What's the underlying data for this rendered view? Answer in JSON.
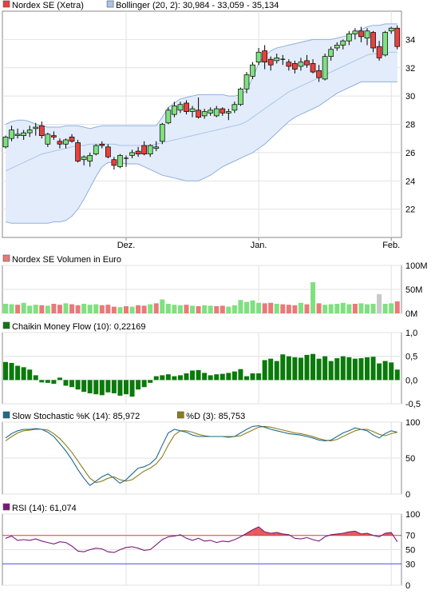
{
  "chart_data": [
    {
      "type": "candlestick",
      "title": "Nordex SE (Xetra)",
      "legend": [
        {
          "swatch": "#e8413c",
          "text": "Nordex SE (Xetra)"
        },
        {
          "swatch": "#a9c4ea",
          "text": "Bollinger (20, 2): 30,984 - 33,059 - 35,134"
        }
      ],
      "ylim": [
        20,
        36
      ],
      "yticks": [
        22,
        24,
        26,
        28,
        30,
        32,
        34
      ],
      "ytick_labels": [
        "22",
        "24",
        "26",
        "28",
        "30",
        "32",
        "34"
      ],
      "xtick_labels": [
        {
          "index": 20,
          "label": "Dez."
        },
        {
          "index": 42,
          "label": "Jan."
        },
        {
          "index": 64,
          "label": "Feb."
        }
      ],
      "ohlc": [
        [
          26.4,
          27.2,
          26.3,
          27.1
        ],
        [
          27.0,
          27.9,
          26.8,
          27.6
        ],
        [
          27.2,
          27.7,
          27.0,
          27.3
        ],
        [
          27.2,
          27.6,
          26.9,
          27.4
        ],
        [
          27.4,
          27.9,
          27.1,
          27.6
        ],
        [
          27.7,
          28.1,
          27.2,
          27.8
        ],
        [
          27.9,
          28.2,
          27.0,
          27.2
        ],
        [
          26.6,
          27.4,
          26.4,
          27.3
        ],
        [
          27.2,
          27.5,
          26.9,
          27.1
        ],
        [
          26.8,
          27.0,
          26.3,
          26.6
        ],
        [
          26.6,
          27.0,
          26.3,
          26.9
        ],
        [
          27.1,
          27.3,
          26.7,
          26.8
        ],
        [
          26.7,
          26.9,
          25.3,
          25.4
        ],
        [
          25.5,
          25.8,
          25.1,
          25.7
        ],
        [
          25.4,
          26.0,
          25.0,
          25.8
        ],
        [
          25.9,
          26.6,
          25.8,
          26.5
        ],
        [
          26.6,
          26.8,
          26.3,
          26.5
        ],
        [
          26.4,
          26.6,
          25.6,
          25.7
        ],
        [
          25.5,
          25.7,
          24.8,
          25.1
        ],
        [
          25.0,
          25.9,
          24.9,
          25.8
        ],
        [
          25.6,
          25.8,
          25.0,
          25.6
        ],
        [
          25.8,
          26.2,
          25.6,
          26.0
        ],
        [
          26.1,
          26.4,
          25.7,
          25.9
        ],
        [
          26.5,
          26.8,
          25.8,
          25.9
        ],
        [
          25.9,
          26.6,
          25.7,
          26.5
        ],
        [
          26.3,
          26.8,
          26.1,
          26.4
        ],
        [
          26.8,
          28.1,
          26.6,
          28.0
        ],
        [
          28.1,
          29.2,
          28.0,
          29.0
        ],
        [
          28.7,
          29.6,
          28.5,
          29.3
        ],
        [
          29.0,
          29.6,
          28.8,
          29.4
        ],
        [
          29.5,
          29.7,
          28.7,
          28.9
        ],
        [
          28.9,
          29.3,
          28.5,
          29.1
        ],
        [
          29.0,
          29.9,
          28.4,
          28.5
        ],
        [
          28.6,
          29.1,
          28.4,
          28.9
        ],
        [
          28.8,
          29.2,
          28.6,
          29.0
        ],
        [
          28.6,
          29.3,
          28.5,
          29.1
        ],
        [
          29.1,
          29.2,
          28.6,
          28.8
        ],
        [
          28.8,
          29.1,
          28.3,
          28.9
        ],
        [
          29.0,
          29.6,
          28.8,
          29.4
        ],
        [
          29.4,
          30.6,
          29.3,
          30.5
        ],
        [
          30.5,
          31.7,
          30.2,
          31.5
        ],
        [
          31.4,
          32.4,
          31.2,
          32.2
        ],
        [
          32.4,
          33.4,
          32.2,
          33.1
        ],
        [
          33.2,
          33.6,
          31.9,
          32.4
        ],
        [
          32.6,
          32.8,
          31.8,
          32.2
        ],
        [
          32.5,
          33.0,
          32.3,
          32.7
        ],
        [
          32.6,
          32.9,
          32.2,
          32.6
        ],
        [
          32.4,
          32.6,
          31.8,
          32.1
        ],
        [
          32.3,
          32.5,
          31.6,
          31.9
        ],
        [
          32.1,
          32.7,
          31.8,
          32.4
        ],
        [
          32.5,
          32.9,
          32.0,
          32.2
        ],
        [
          32.3,
          32.6,
          31.6,
          31.7
        ],
        [
          31.8,
          32.2,
          31.0,
          31.3
        ],
        [
          31.2,
          33.0,
          31.1,
          32.8
        ],
        [
          32.8,
          33.5,
          32.5,
          33.3
        ],
        [
          33.4,
          33.8,
          33.2,
          33.6
        ],
        [
          33.6,
          34.0,
          33.3,
          33.9
        ],
        [
          33.9,
          34.6,
          33.6,
          34.4
        ],
        [
          34.4,
          34.8,
          34.0,
          34.6
        ],
        [
          34.6,
          34.9,
          33.8,
          34.2
        ],
        [
          34.1,
          34.8,
          33.6,
          34.6
        ],
        [
          34.5,
          34.6,
          33.1,
          33.4
        ],
        [
          33.5,
          33.9,
          32.5,
          32.7
        ],
        [
          32.9,
          34.6,
          32.8,
          34.5
        ],
        [
          34.6,
          34.9,
          34.4,
          34.8
        ],
        [
          34.8,
          35.0,
          33.3,
          33.5
        ]
      ],
      "bollinger_upper": [
        28.0,
        28.2,
        28.3,
        28.3,
        28.2,
        28.0,
        27.9,
        27.8,
        27.8,
        27.8,
        27.9,
        27.9,
        27.9,
        27.8,
        27.7,
        27.8,
        27.9,
        27.9,
        27.9,
        27.9,
        27.9,
        27.9,
        27.9,
        27.9,
        27.9,
        27.9,
        28.5,
        29.2,
        29.5,
        29.8,
        29.9,
        30.0,
        30.1,
        30.1,
        30.1,
        30.1,
        30.1,
        30.0,
        30.0,
        30.1,
        30.4,
        31.3,
        32.3,
        32.8,
        33.2,
        33.4,
        33.5,
        33.6,
        33.7,
        33.8,
        33.9,
        34.0,
        34.0,
        34.0,
        34.0,
        34.1,
        34.2,
        34.3,
        34.5,
        34.7,
        34.9,
        35.0,
        35.0,
        35.1,
        35.1,
        35.1
      ],
      "bollinger_mid": [
        24.7,
        24.9,
        25.1,
        25.3,
        25.5,
        25.7,
        25.9,
        26.0,
        26.1,
        26.2,
        26.3,
        26.4,
        26.5,
        26.5,
        26.6,
        26.6,
        26.6,
        26.6,
        26.6,
        26.5,
        26.5,
        26.5,
        26.5,
        26.5,
        26.5,
        26.6,
        26.7,
        26.8,
        26.9,
        27.0,
        27.1,
        27.2,
        27.3,
        27.4,
        27.5,
        27.6,
        27.7,
        27.8,
        27.9,
        28.0,
        28.2,
        28.5,
        28.8,
        29.1,
        29.4,
        29.7,
        30.0,
        30.3,
        30.5,
        30.7,
        30.9,
        31.1,
        31.3,
        31.5,
        31.7,
        31.9,
        32.1,
        32.3,
        32.5,
        32.7,
        32.9,
        33.0,
        33.0,
        33.0,
        33.1,
        33.1
      ],
      "bollinger_lower": [
        21.1,
        21.0,
        21.0,
        21.0,
        21.0,
        21.0,
        21.0,
        21.0,
        21.1,
        21.1,
        21.2,
        21.5,
        22.0,
        22.7,
        23.5,
        24.3,
        25.0,
        25.3,
        25.3,
        25.3,
        25.2,
        25.2,
        25.2,
        25.0,
        24.8,
        24.6,
        24.4,
        24.3,
        24.2,
        24.1,
        24.0,
        24.0,
        24.0,
        24.2,
        24.4,
        24.7,
        25.0,
        25.2,
        25.4,
        25.6,
        25.8,
        26.0,
        26.3,
        26.6,
        27.0,
        27.4,
        27.8,
        28.2,
        28.5,
        28.7,
        28.9,
        29.1,
        29.3,
        29.6,
        29.9,
        30.2,
        30.4,
        30.6,
        30.8,
        31.0,
        31.0,
        31.0,
        31.0,
        31.0,
        31.0,
        31.0
      ]
    },
    {
      "type": "bar",
      "title": "Nordex SE Volumen in Euro",
      "legend": [
        {
          "swatch": "#e87a7a",
          "text": "Nordex SE Volumen in Euro"
        }
      ],
      "ylim": [
        0,
        100
      ],
      "yticks": [
        0,
        50,
        100
      ],
      "ytick_labels": [
        "0M",
        "50M",
        "100M"
      ],
      "values": [
        20,
        19,
        18,
        22,
        16,
        18,
        17,
        16,
        20,
        18,
        21,
        19,
        17,
        20,
        18,
        19,
        17,
        18,
        14,
        13,
        15,
        14,
        17,
        16,
        19,
        21,
        29,
        20,
        18,
        17,
        18,
        16,
        15,
        17,
        16,
        15,
        16,
        14,
        17,
        28,
        24,
        27,
        22,
        21,
        22,
        20,
        19,
        18,
        17,
        22,
        19,
        65,
        21,
        18,
        19,
        20,
        22,
        19,
        20,
        21,
        19,
        20,
        40,
        20,
        21,
        25
      ],
      "colors": [
        "green",
        "green",
        "red",
        "green",
        "green",
        "green",
        "red",
        "green",
        "red",
        "red",
        "green",
        "red",
        "red",
        "green",
        "green",
        "green",
        "red",
        "red",
        "red",
        "green",
        "red",
        "green",
        "red",
        "red",
        "green",
        "red",
        "green",
        "green",
        "green",
        "green",
        "red",
        "green",
        "red",
        "green",
        "green",
        "red",
        "red",
        "green",
        "green",
        "green",
        "green",
        "green",
        "green",
        "red",
        "red",
        "green",
        "red",
        "red",
        "red",
        "green",
        "red",
        "green",
        "red",
        "green",
        "green",
        "green",
        "green",
        "green",
        "red",
        "green",
        "green",
        "green",
        "gray",
        "green",
        "green",
        "red"
      ]
    },
    {
      "type": "bar",
      "title": "Chaikin Money Flow (10): 0,22169",
      "legend": [
        {
          "swatch": "#0a7a0a",
          "text": "Chaikin Money Flow (10): 0,22169"
        }
      ],
      "ylim": [
        -0.5,
        1
      ],
      "yticks": [
        -0.5,
        0,
        0.5,
        1
      ],
      "ytick_labels": [
        "-0,5",
        "0,0",
        "0,5",
        "1,0"
      ],
      "values": [
        0.38,
        0.36,
        0.3,
        0.27,
        0.22,
        0.1,
        -0.05,
        -0.06,
        -0.08,
        0.05,
        -0.12,
        -0.15,
        -0.2,
        -0.25,
        -0.28,
        -0.3,
        -0.32,
        -0.26,
        -0.28,
        -0.33,
        -0.3,
        -0.35,
        -0.2,
        -0.15,
        -0.06,
        0.08,
        0.1,
        0.12,
        0.08,
        0.1,
        0.14,
        0.2,
        0.21,
        0.15,
        0.1,
        0.12,
        0.13,
        0.15,
        0.18,
        0.23,
        0.08,
        0.14,
        0.14,
        0.42,
        0.45,
        0.4,
        0.54,
        0.5,
        0.48,
        0.47,
        0.53,
        0.55,
        0.45,
        0.5,
        0.4,
        0.46,
        0.5,
        0.48,
        0.45,
        0.46,
        0.48,
        0.49,
        0.35,
        0.4,
        0.37,
        0.22
      ]
    },
    {
      "type": "line",
      "title": "Slow Stochastic %K (14): 85,972",
      "legend": [
        {
          "swatch": "#1d6b8a",
          "text": "Slow Stochastic %K (14): 85,972"
        },
        {
          "swatch": "#8b7d1c",
          "text": "%D (3): 85,753"
        }
      ],
      "ylim": [
        0,
        100
      ],
      "yticks": [
        0,
        50,
        100
      ],
      "ytick_labels": [
        "0",
        "50",
        "100"
      ],
      "series": [
        {
          "name": "Slow Stochastic %K (14): 85,972",
          "color": "#1d6b8a",
          "values": [
            78,
            84,
            88,
            90,
            90,
            91,
            90,
            86,
            80,
            70,
            60,
            48,
            34,
            22,
            12,
            18,
            24,
            28,
            22,
            15,
            20,
            28,
            36,
            38,
            42,
            50,
            68,
            85,
            90,
            88,
            86,
            82,
            80,
            80,
            80,
            80,
            80,
            79,
            80,
            85,
            90,
            94,
            95,
            93,
            90,
            88,
            86,
            84,
            83,
            82,
            80,
            78,
            75,
            74,
            75,
            80,
            85,
            88,
            92,
            90,
            88,
            82,
            78,
            84,
            88,
            86
          ]
        },
        {
          "name": "%D (3): 85,753",
          "color": "#8b7d1c",
          "values": [
            74,
            80,
            85,
            88,
            89,
            90,
            90,
            89,
            84,
            77,
            68,
            58,
            46,
            34,
            22,
            16,
            18,
            22,
            24,
            20,
            18,
            20,
            26,
            32,
            36,
            42,
            52,
            68,
            82,
            88,
            88,
            86,
            83,
            81,
            80,
            80,
            80,
            80,
            80,
            81,
            85,
            89,
            93,
            94,
            93,
            91,
            89,
            87,
            85,
            84,
            82,
            80,
            77,
            75,
            74,
            76,
            80,
            84,
            88,
            90,
            90,
            87,
            83,
            81,
            84,
            86
          ]
        }
      ]
    },
    {
      "type": "line",
      "title": "RSI (14): 61,074",
      "legend": [
        {
          "swatch": "#7a1a7a",
          "text": "RSI (14): 61,074"
        }
      ],
      "ylim": [
        0,
        100
      ],
      "yticks": [
        0,
        50,
        100
      ],
      "ytick_labels": [
        "0",
        "50",
        "100"
      ],
      "reference_lines": [
        {
          "value": 70,
          "label": "70",
          "color": "#d23c3c"
        },
        {
          "value": 30,
          "label": "30",
          "color": "#4a4ae0"
        }
      ],
      "series": [
        {
          "name": "RSI (14): 61,074",
          "color": "#7a1a7a",
          "values": [
            66,
            69,
            63,
            64,
            63,
            65,
            62,
            60,
            58,
            61,
            60,
            55,
            48,
            47,
            50,
            52,
            51,
            47,
            46,
            50,
            53,
            54,
            52,
            49,
            50,
            57,
            64,
            68,
            69,
            71,
            66,
            63,
            66,
            62,
            63,
            60,
            62,
            61,
            64,
            68,
            73,
            78,
            82,
            75,
            73,
            74,
            72,
            71,
            66,
            65,
            67,
            64,
            62,
            68,
            71,
            72,
            73,
            75,
            76,
            72,
            73,
            70,
            68,
            73,
            74,
            61
          ]
        }
      ]
    }
  ]
}
